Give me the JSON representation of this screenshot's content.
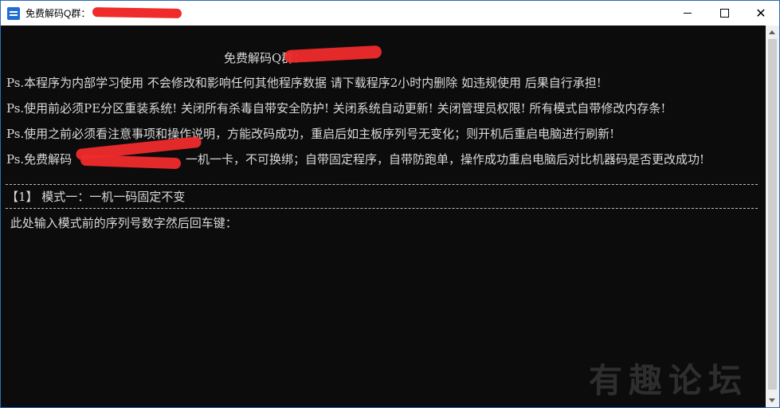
{
  "window": {
    "title": "免费解码Q群：",
    "controls": {
      "minimize_icon": "minimize-icon",
      "maximize_icon": "maximize-icon",
      "close_icon": "close-icon",
      "close_glyph": "✕"
    },
    "app_icon": "console-app-icon"
  },
  "console": {
    "header": "免费解码Q群：",
    "notices": [
      "Ps.本程序为内部学习使用 不会修改和影响任何其他程序数据 请下载程序2小时内删除 如违规使用 后果自行承担!",
      "Ps.使用前必须PE分区重装系统! 关闭所有杀毒自带安全防护! 关闭系统自动更新! 关闭管理员权限! 所有模式自带修改内存条!",
      "Ps.使用之前必须看注意事项和操作说明，方能改码成功，重启后如主板序列号无变化；则开机后重启电脑进行刷新!",
      "Ps.免费解码",
      "一机一卡，不可换绑；自带固定程序，自带防跑单，操作成功重启电脑后对比机器码是否更改成功!"
    ],
    "mode_line": "【1】 模式一：一机一码固定不变",
    "prompt": " 此处输入模式前的序列号数字然后回车键："
  },
  "watermark": "有趣论坛",
  "colors": {
    "console_bg": "#0c0c0c",
    "console_text": "#d9d9d9",
    "redaction": "#ef2b2b"
  }
}
